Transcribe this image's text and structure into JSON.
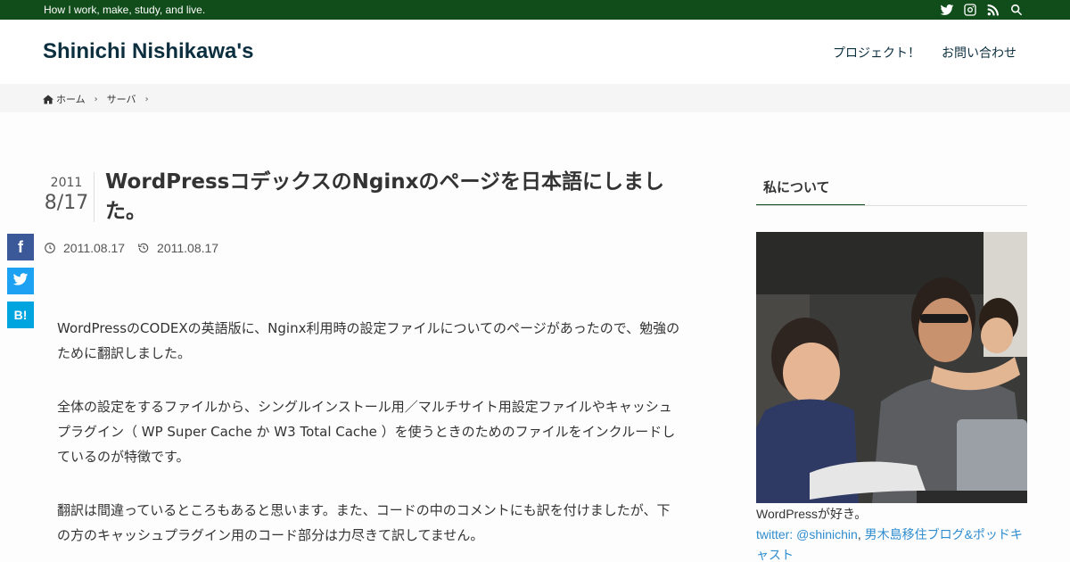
{
  "topbar": {
    "tagline": "How I work, make, study, and live.",
    "icons": [
      "twitter-icon",
      "instagram-icon",
      "rss-icon",
      "search-icon"
    ],
    "bg_color": "#114d1a"
  },
  "header": {
    "site_title": "Shinichi Nishikawa's",
    "nav": [
      {
        "label": "プロジェクト！"
      },
      {
        "label": "お問い合わせ"
      }
    ]
  },
  "breadcrumb": {
    "items": [
      {
        "label": "ホーム",
        "icon": "home-icon"
      },
      {
        "label": "サーバ"
      }
    ]
  },
  "post": {
    "date_year": "2011",
    "date_md": "8/17",
    "title": "WordPressコデックスのNginxのページを日本語にしました。",
    "published": "2011.08.17",
    "updated": "2011.08.17",
    "paragraphs": [
      "WordPressのCODEXの英語版に、Nginx利用時の設定ファイルについてのページがあったので、勉強のために翻訳しました。",
      "全体の設定をするファイルから、シングルインストール用／マルチサイト用設定ファイルやキャッシュプラグイン（ WP Super Cache か W3 Total Cache ）を使うときのためのファイルをインクルードしているのが特徴です。",
      "翻訳は間違っているところもあると思います。また、コードの中のコメントにも訳を付けましたが、下の方のキャッシュプラグイン用のコード部分は力尽きて訳してません。"
    ]
  },
  "share": {
    "facebook_label": "f",
    "hatena_label": "B!"
  },
  "sidebar": {
    "widget_title": "私について",
    "profile_line": "WordPressが好き。",
    "twitter_link": "twitter: @shinichin",
    "separator": ",",
    "blog_link": "男木島移住ブログ&ポッドキャスト"
  },
  "colors": {
    "accent_green": "#114d1a",
    "title_navy": "#0c2f3f",
    "link_blue": "#2e8ccf"
  }
}
